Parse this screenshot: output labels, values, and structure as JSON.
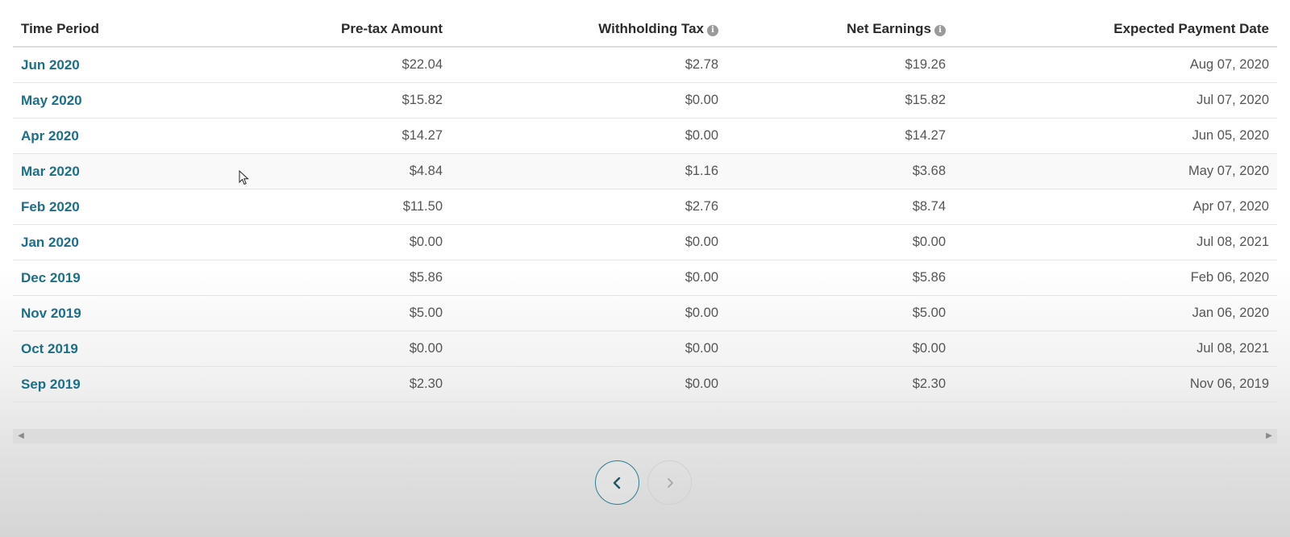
{
  "table": {
    "headers": {
      "time_period": "Time Period",
      "pretax": "Pre-tax Amount",
      "withholding": "Withholding Tax",
      "net": "Net Earnings",
      "payment_date": "Expected Payment Date"
    },
    "rows": [
      {
        "period": "Jun 2020",
        "pretax": "$22.04",
        "withholding": "$2.78",
        "net": "$19.26",
        "date": "Aug 07, 2020"
      },
      {
        "period": "May 2020",
        "pretax": "$15.82",
        "withholding": "$0.00",
        "net": "$15.82",
        "date": "Jul 07, 2020"
      },
      {
        "period": "Apr 2020",
        "pretax": "$14.27",
        "withholding": "$0.00",
        "net": "$14.27",
        "date": "Jun 05, 2020"
      },
      {
        "period": "Mar 2020",
        "pretax": "$4.84",
        "withholding": "$1.16",
        "net": "$3.68",
        "date": "May 07, 2020"
      },
      {
        "period": "Feb 2020",
        "pretax": "$11.50",
        "withholding": "$2.76",
        "net": "$8.74",
        "date": "Apr 07, 2020"
      },
      {
        "period": "Jan 2020",
        "pretax": "$0.00",
        "withholding": "$0.00",
        "net": "$0.00",
        "date": "Jul 08, 2021"
      },
      {
        "period": "Dec 2019",
        "pretax": "$5.86",
        "withholding": "$0.00",
        "net": "$5.86",
        "date": "Feb 06, 2020"
      },
      {
        "period": "Nov 2019",
        "pretax": "$5.00",
        "withholding": "$0.00",
        "net": "$5.00",
        "date": "Jan 06, 2020"
      },
      {
        "period": "Oct 2019",
        "pretax": "$0.00",
        "withholding": "$0.00",
        "net": "$0.00",
        "date": "Jul 08, 2021"
      },
      {
        "period": "Sep 2019",
        "pretax": "$2.30",
        "withholding": "$0.00",
        "net": "$2.30",
        "date": "Nov 06, 2019"
      }
    ]
  },
  "icons": {
    "info": "info-icon",
    "prev": "chevron-left-icon",
    "next": "chevron-right-icon"
  },
  "colors": {
    "link": "#1b6f8a",
    "accent": "#2b7f96",
    "disabled": "#bdbdbd"
  }
}
